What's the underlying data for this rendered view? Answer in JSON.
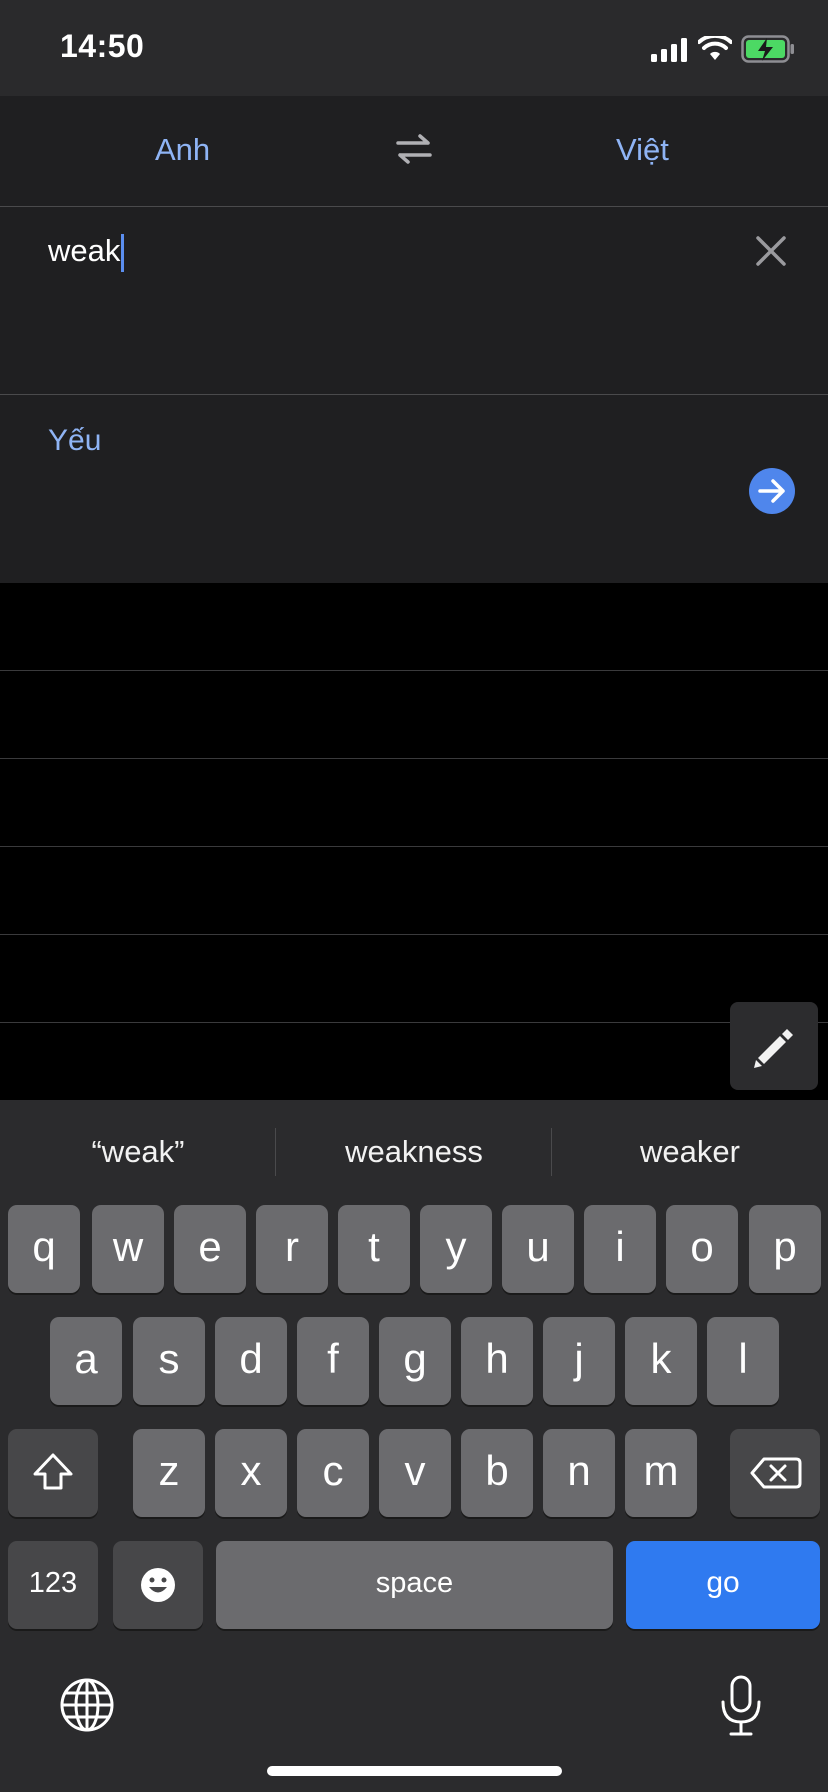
{
  "status_bar": {
    "time": "14:50",
    "icons": [
      "signal-icon",
      "wifi-icon",
      "battery-charging-icon"
    ]
  },
  "languages": {
    "source": "Anh",
    "target": "Việt",
    "swap_icon": "swap-arrows-icon"
  },
  "input": {
    "text": "weak",
    "clear_icon": "close-icon"
  },
  "translation": {
    "text": "Yếu",
    "go_icon": "arrow-right-icon"
  },
  "handwriting_icon": "pen-icon",
  "keyboard": {
    "suggestions": [
      "“weak”",
      "weakness",
      "weaker"
    ],
    "row1": [
      "q",
      "w",
      "e",
      "r",
      "t",
      "y",
      "u",
      "i",
      "o",
      "p"
    ],
    "row2": [
      "a",
      "s",
      "d",
      "f",
      "g",
      "h",
      "j",
      "k",
      "l"
    ],
    "row3": [
      "z",
      "x",
      "c",
      "v",
      "b",
      "n",
      "m"
    ],
    "numbers_label": "123",
    "space_label": "space",
    "go_label": "go",
    "icons": [
      "shift-icon",
      "backspace-icon",
      "emoji-icon",
      "globe-icon",
      "microphone-icon"
    ]
  },
  "colors": {
    "accent": "#8fb4f5",
    "go_key": "#2f7af0",
    "battery": "#4cd964"
  }
}
